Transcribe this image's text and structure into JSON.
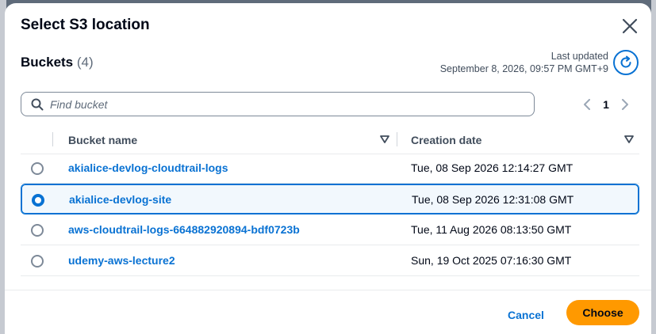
{
  "modal": {
    "title": "Select S3 location",
    "close_icon": "close-icon"
  },
  "buckets": {
    "heading": "Buckets",
    "count": "(4)",
    "last_updated_label": "Last updated",
    "last_updated_value": "September 8, 2026, 09:57 PM GMT+9",
    "refresh_icon": "refresh-icon"
  },
  "search": {
    "placeholder": "Find bucket",
    "value": ""
  },
  "pagination": {
    "current_page": "1"
  },
  "table": {
    "columns": [
      "Bucket name",
      "Creation date"
    ],
    "rows": [
      {
        "name": "akialice-devlog-cloudtrail-logs",
        "date": "Tue, 08 Sep 2026 12:14:27 GMT",
        "selected": false
      },
      {
        "name": "akialice-devlog-site",
        "date": "Tue, 08 Sep 2026 12:31:08 GMT",
        "selected": true
      },
      {
        "name": "aws-cloudtrail-logs-664882920894-bdf0723b",
        "date": "Tue, 11 Aug 2026 08:13:50 GMT",
        "selected": false
      },
      {
        "name": "udemy-aws-lecture2",
        "date": "Sun, 19 Oct 2025 07:16:30 GMT",
        "selected": false
      }
    ]
  },
  "footer": {
    "cancel_label": "Cancel",
    "choose_label": "Choose"
  },
  "colors": {
    "accent": "#0972d3",
    "primary_button": "#ff9900"
  }
}
